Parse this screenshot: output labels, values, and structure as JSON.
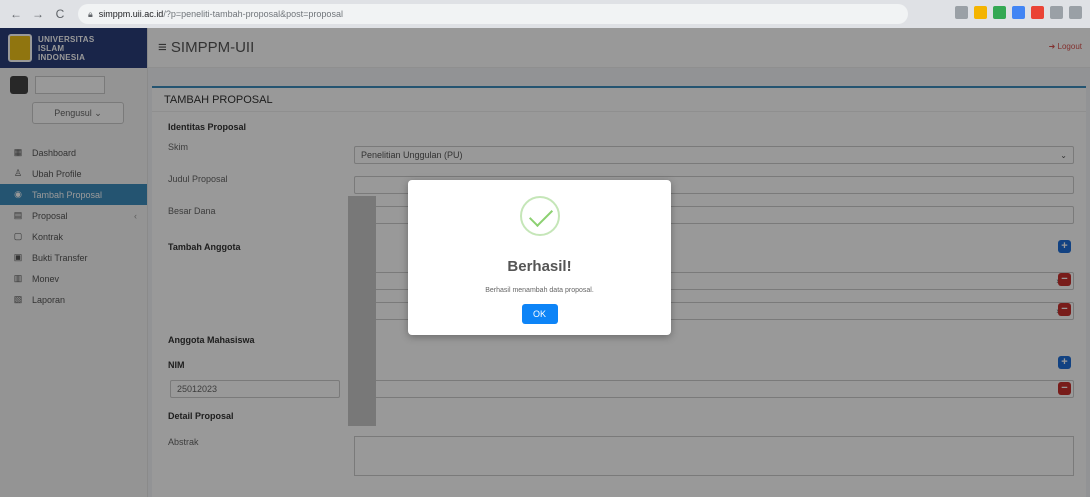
{
  "browser": {
    "back": "←",
    "forward": "→",
    "reload": "C",
    "url_host": "simppm.uii.ac.id",
    "url_path": "/?p=peneliti-tambah-proposal&post=proposal"
  },
  "brand": {
    "line1": "UNIVERSITAS",
    "line2": "ISLAM",
    "line3": "INDONESIA"
  },
  "app": {
    "title": "≡  SIMPPM-UII",
    "logout": "➜ Logout"
  },
  "user": {
    "role": "Pengusul  ⌄"
  },
  "sidebar": {
    "items": [
      {
        "icon": "▦",
        "label": "Dashboard"
      },
      {
        "icon": "♙",
        "label": "Ubah Profile"
      },
      {
        "icon": "◉",
        "label": "Tambah Proposal"
      },
      {
        "icon": "▤",
        "label": "Proposal",
        "caret": "‹"
      },
      {
        "icon": "▢",
        "label": "Kontrak"
      },
      {
        "icon": "▣",
        "label": "Bukti Transfer"
      },
      {
        "icon": "▥",
        "label": "Monev"
      },
      {
        "icon": "▧",
        "label": "Laporan"
      }
    ]
  },
  "form": {
    "panel_title": "TAMBAH PROPOSAL",
    "identitas": "Identitas Proposal",
    "skim_label": "Skim",
    "skim_value": "Penelitian Unggulan (PU)",
    "judul_label": "Judul Proposal",
    "dana_label": "Besar Dana",
    "tambah_anggota": "Tambah Anggota",
    "anggota_mahasiswa": "Anggota Mahasiswa",
    "nim_label": "NIM",
    "nim_value": "25012023",
    "detail": "Detail Proposal",
    "abstrak_label": "Abstrak",
    "select_clear": "×  ▾"
  },
  "modal": {
    "title": "Berhasil!",
    "message": "Berhasil menambah data proposal.",
    "ok": "OK"
  }
}
